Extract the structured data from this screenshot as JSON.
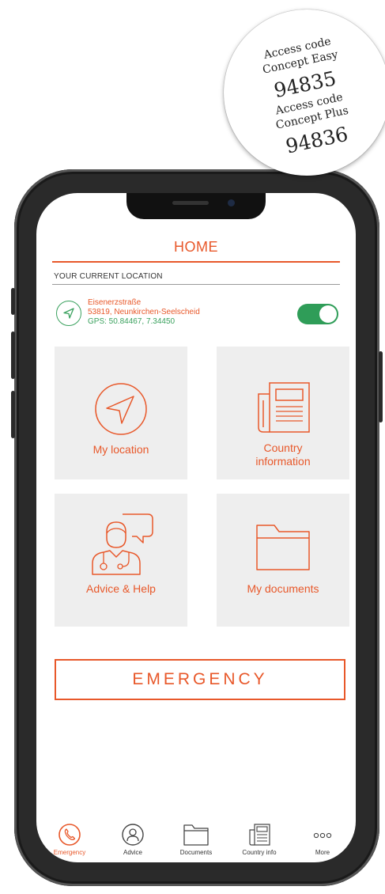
{
  "badge": {
    "easy_label_1": "Access code",
    "easy_label_2": "Concept Easy",
    "easy_code": "94835",
    "plus_label_1": "Access code",
    "plus_label_2": "Concept Plus",
    "plus_code": "94836"
  },
  "screen": {
    "title": "HOME",
    "location_header": "YOUR CURRENT LOCATION",
    "street": "Eisenerzstraße",
    "city": "53819, Neunkirchen-Seelscheid",
    "gps": "GPS: 50.84467, 7.34450",
    "location_toggle_on": true
  },
  "tiles": [
    {
      "label": "My location",
      "icon": "navigation-arrow-icon"
    },
    {
      "label": "Country information",
      "label_line1": "Country",
      "label_line2": "information",
      "icon": "newspaper-icon"
    },
    {
      "label": "Advice & Help",
      "icon": "doctor-chat-icon"
    },
    {
      "label": "My documents",
      "icon": "folder-icon"
    }
  ],
  "emergency_button": "EMERGENCY",
  "tabs": [
    {
      "label": "Emergency",
      "icon": "phone-icon",
      "active": true
    },
    {
      "label": "Advice",
      "icon": "doctor-icon",
      "active": false
    },
    {
      "label": "Documents",
      "icon": "folder-icon",
      "active": false
    },
    {
      "label": "Country info",
      "icon": "newspaper-icon",
      "active": false
    },
    {
      "label": "More",
      "icon": "more-dots-icon",
      "active": false
    }
  ],
  "colors": {
    "accent": "#e8582a",
    "green": "#3aa15e",
    "toggle_green": "#2f9d58",
    "tile_bg": "#eeeeee"
  }
}
